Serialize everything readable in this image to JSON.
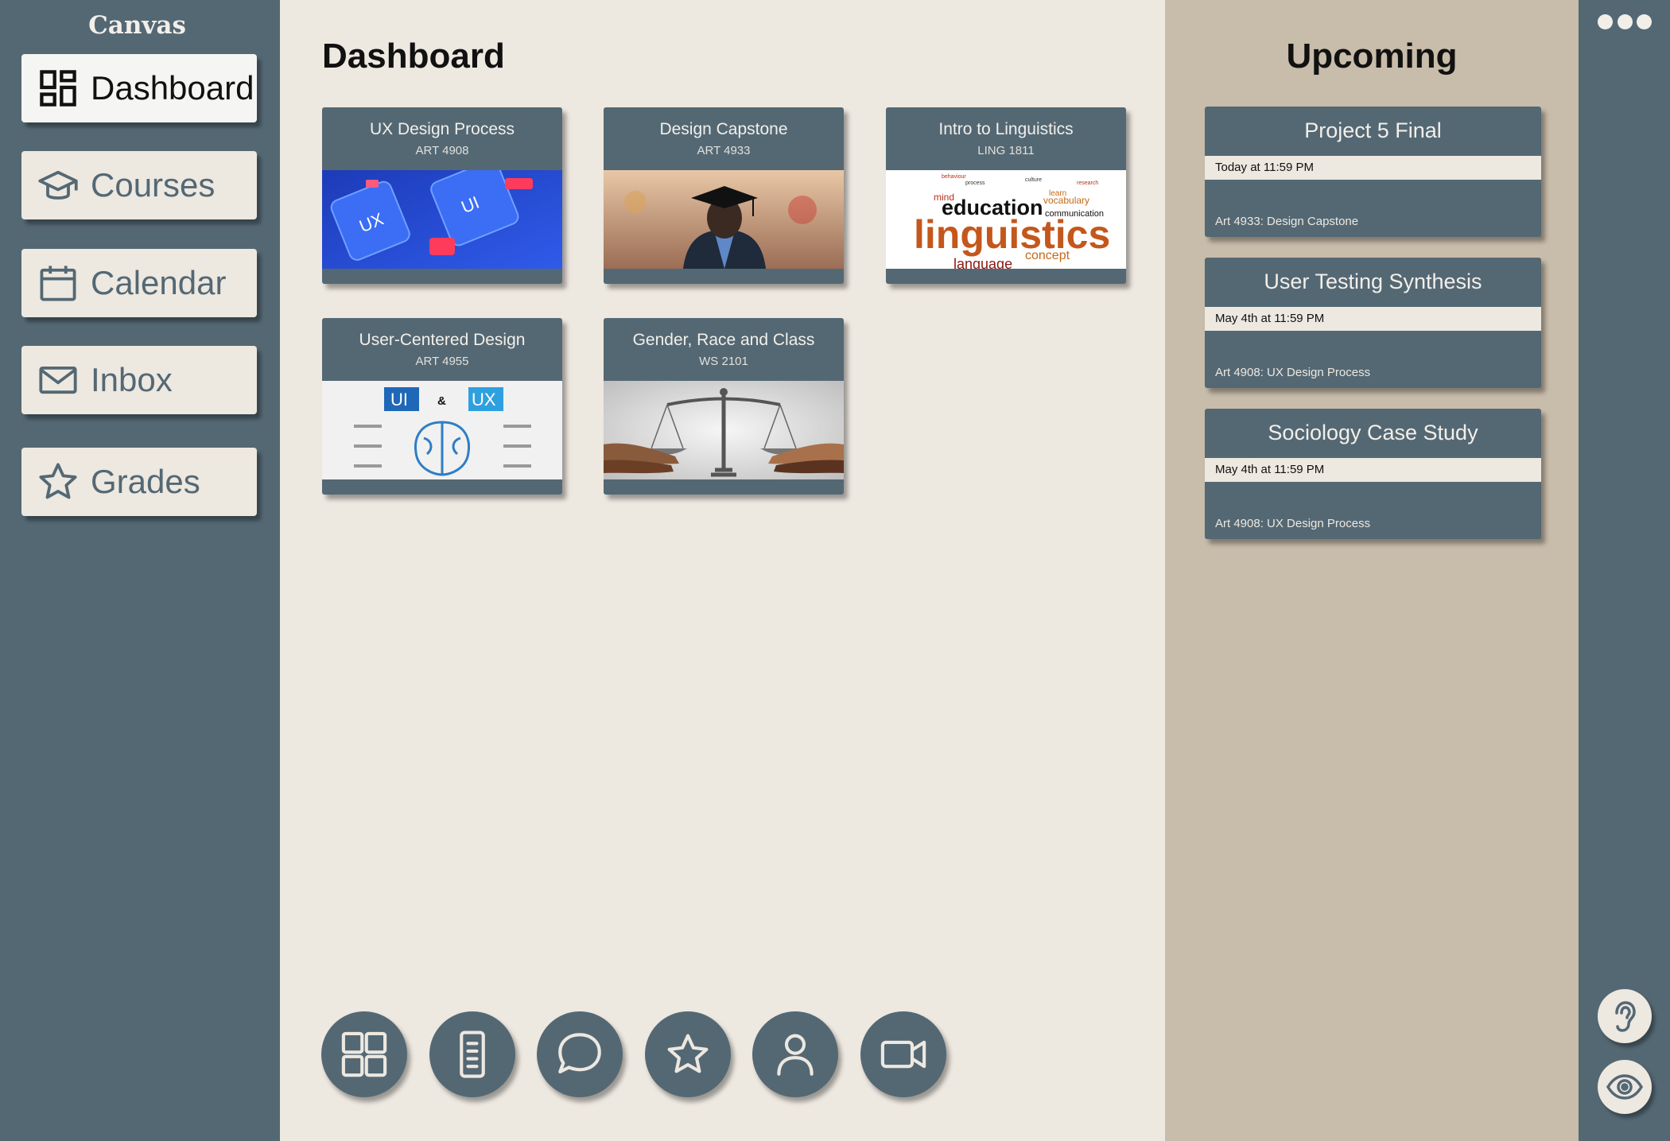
{
  "brand": "Canvas",
  "sidebar": {
    "items": [
      {
        "label": "Dashboard",
        "icon": "dashboard-icon",
        "active": true
      },
      {
        "label": "Courses",
        "icon": "graduation-cap-icon",
        "active": false
      },
      {
        "label": "Calendar",
        "icon": "calendar-icon",
        "active": false
      },
      {
        "label": "Inbox",
        "icon": "mail-icon",
        "active": false
      },
      {
        "label": "Grades",
        "icon": "star-icon",
        "active": false
      }
    ]
  },
  "main": {
    "title": "Dashboard",
    "courses": [
      {
        "title": "UX Design Process",
        "code": "ART 4908",
        "image": "ux-phones-image"
      },
      {
        "title": "Design Capstone",
        "code": "ART 4933",
        "image": "graduate-image"
      },
      {
        "title": "Intro to Linguistics",
        "code": "LING 1811",
        "image": "linguistics-word-cloud-image"
      },
      {
        "title": "User-Centered Design",
        "code": "ART 4955",
        "image": "ui-ux-brain-image"
      },
      {
        "title": "Gender, Race and Class",
        "code": "WS 2101",
        "image": "scales-of-justice-image"
      }
    ],
    "image_text": {
      "ux": [
        "UX",
        "UI"
      ],
      "cloud": [
        "behaviour",
        "process",
        "mind",
        "education",
        "vocabulary",
        "communication",
        "linguistics",
        "concept",
        "language",
        "learn",
        "research",
        "culture"
      ],
      "uiux": [
        "UI",
        "&",
        "UX"
      ]
    },
    "toolbar": [
      {
        "icon": "grid-icon"
      },
      {
        "icon": "document-icon"
      },
      {
        "icon": "chat-bubble-icon"
      },
      {
        "icon": "star-icon"
      },
      {
        "icon": "user-icon"
      },
      {
        "icon": "video-camera-icon"
      }
    ]
  },
  "upcoming": {
    "title": "Upcoming",
    "items": [
      {
        "title": "Project 5 Final",
        "due": "Today at 11:59 PM",
        "course": "Art 4933: Design Capstone"
      },
      {
        "title": "User Testing Synthesis",
        "due": "May 4th at 11:59 PM",
        "course": "Art 4908: UX Design Process"
      },
      {
        "title": "Sociology Case Study",
        "due": "May 4th at 11:59 PM",
        "course": "Art 4908: UX Design Process"
      }
    ]
  },
  "rail": {
    "more_icon": "more-dots-icon",
    "buttons": [
      {
        "icon": "ear-icon"
      },
      {
        "icon": "eye-icon"
      }
    ]
  },
  "colors": {
    "slate": "#546874",
    "cream": "#ede8e0",
    "tan": "#c8bcaa"
  }
}
